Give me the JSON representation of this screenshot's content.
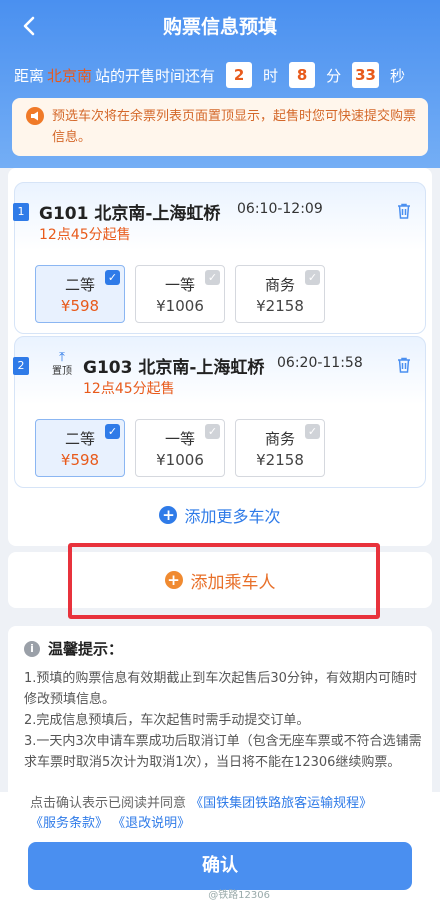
{
  "header": {
    "title": "购票信息预填",
    "back_icon": "chevron-left-icon"
  },
  "countdown": {
    "prefix": "距离",
    "station": "北京南",
    "middle": "站的开售时间还有",
    "hours": "2",
    "hours_unit": "时",
    "minutes": "8",
    "minutes_unit": "分",
    "seconds": "33",
    "seconds_unit": "秒"
  },
  "notice": {
    "icon": "megaphone-icon",
    "text": "预选车次将在余票列表页面置顶显示，起售时您可快速提交购票信息。"
  },
  "trains": [
    {
      "index": "1",
      "pinned": false,
      "train_no": "G101",
      "route": "北京南-上海虹桥",
      "time": "06:10-12:09",
      "sale": "12点45分起售",
      "seats": [
        {
          "name": "二等",
          "price": "¥598",
          "selected": true
        },
        {
          "name": "一等",
          "price": "¥1006",
          "selected": false
        },
        {
          "name": "商务",
          "price": "¥2158",
          "selected": false
        }
      ]
    },
    {
      "index": "2",
      "pinned": true,
      "pin_label": "置顶",
      "train_no": "G103",
      "route": "北京南-上海虹桥",
      "time": "06:20-11:58",
      "sale": "12点45分起售",
      "seats": [
        {
          "name": "二等",
          "price": "¥598",
          "selected": true
        },
        {
          "name": "一等",
          "price": "¥1006",
          "selected": false
        },
        {
          "name": "商务",
          "price": "¥2158",
          "selected": false
        }
      ]
    }
  ],
  "add_more_trains": "添加更多车次",
  "add_passenger": "添加乘车人",
  "tips": {
    "title": "温馨提示：",
    "items": [
      "1.预填的购票信息有效期截止到车次起售后30分钟，有效期内可随时修改预填信息。",
      "2.完成信息预填后，车次起售时需手动提交订单。",
      "3.一天内3次申请车票成功后取消订单（包含无座车票或不符合选铺需求车票时取消5次计为取消1次），当日将不能在12306继续购票。"
    ]
  },
  "footer": {
    "agree_prefix": "点击确认表示已阅读并同意",
    "link1": "《国铁集团铁路旅客运输规程》",
    "link2": "《服务条款》",
    "link3": "《退改说明》",
    "confirm": "确认",
    "watermark": "@铁路12306"
  },
  "colors": {
    "primary": "#4a8ff0",
    "accent_orange": "#e85a1b",
    "highlight_red": "#e8323c"
  }
}
